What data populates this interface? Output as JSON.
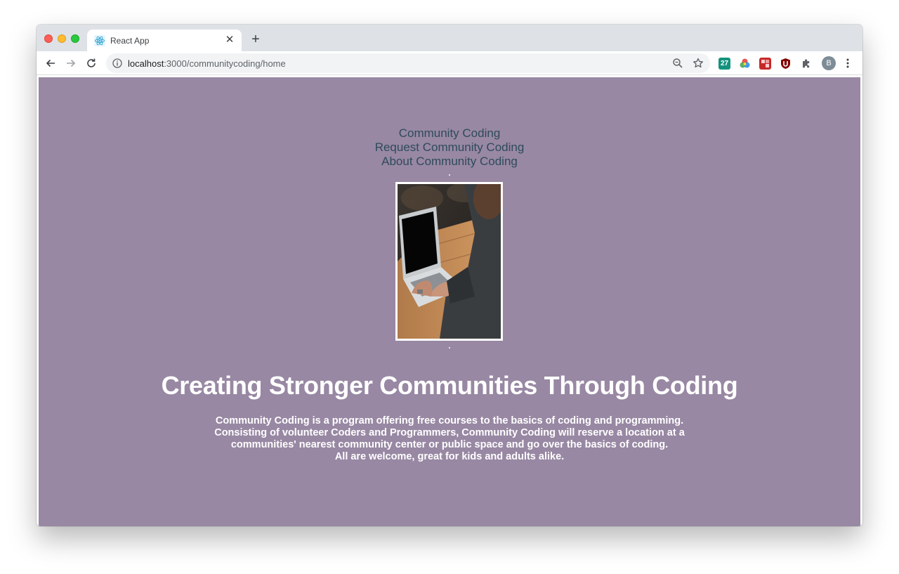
{
  "browser": {
    "tab_title": "React App",
    "url_host": "localhost",
    "url_path": ":3000/communitycoding/home",
    "profile_initial": "B",
    "extensions": [
      "calendar-27-extension",
      "color-wheel-extension",
      "red-square-extension",
      "ublock-extension",
      "puzzle-extensions"
    ]
  },
  "nav": {
    "links": [
      "Community Coding",
      "Request Community Coding",
      "About Community Coding"
    ]
  },
  "hero": {
    "image_subject": "person typing on laptop at wooden table",
    "headline": "Creating Stronger Communities Through Coding",
    "description": [
      "Community Coding is a program offering free courses to the basics of coding and programming.",
      "Consisting of volunteer Coders and Programmers, Community Coding will reserve a location at a",
      "communities' nearest community center or public space and go over the basics of coding.",
      "All are welcome, great for kids and adults alike."
    ]
  },
  "colors": {
    "page_background": "#9888a3",
    "nav_link": "#2f4a5c",
    "headline": "#ffffff"
  }
}
